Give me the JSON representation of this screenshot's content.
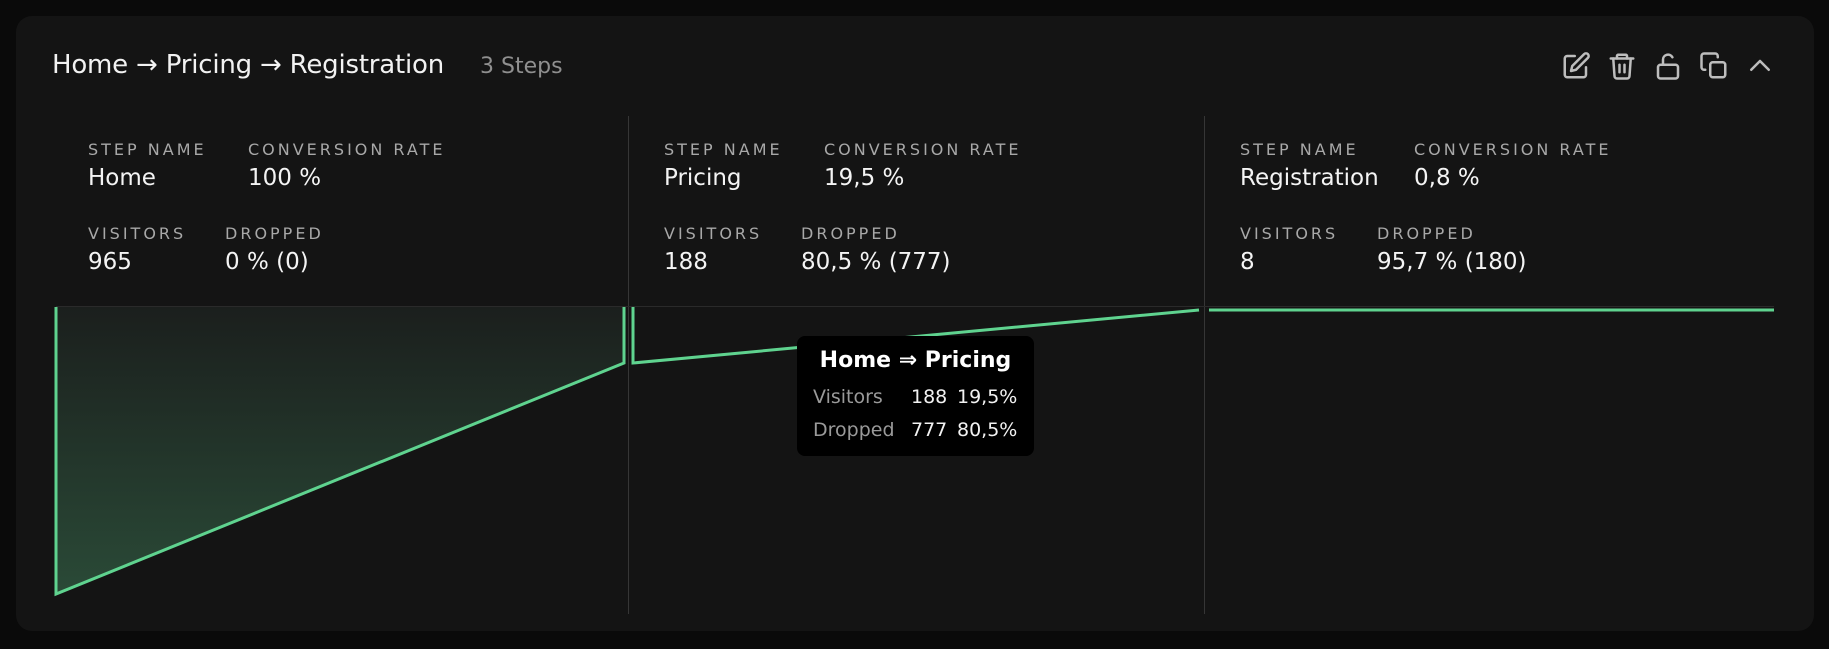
{
  "header": {
    "title": "Home → Pricing → Registration",
    "steps_label": "3 Steps"
  },
  "actions": [
    {
      "name": "edit-icon"
    },
    {
      "name": "trash-icon"
    },
    {
      "name": "unlock-icon"
    },
    {
      "name": "copy-icon"
    },
    {
      "name": "chevron-up-icon"
    }
  ],
  "labels": {
    "step_name": "STEP NAME",
    "conversion_rate": "CONVERSION RATE",
    "visitors": "VISITORS",
    "dropped": "DROPPED"
  },
  "steps": [
    {
      "name": "Home",
      "conversion_rate": "100 %",
      "visitors": "965",
      "dropped": "0 % (0)"
    },
    {
      "name": "Pricing",
      "conversion_rate": "19,5 %",
      "visitors": "188",
      "dropped": "80,5 % (777)"
    },
    {
      "name": "Registration",
      "conversion_rate": "0,8 %",
      "visitors": "8",
      "dropped": "95,7 % (180)"
    }
  ],
  "tooltip": {
    "title": "Home ⇒ Pricing",
    "visitors_label": "Visitors",
    "visitors_count": "188",
    "visitors_pct": "19,5%",
    "dropped_label": "Dropped",
    "dropped_count": "777",
    "dropped_pct": "80,5%"
  },
  "colors": {
    "accent": "#5fd38f",
    "background": "#141414",
    "page": "#0a0a0a"
  }
}
